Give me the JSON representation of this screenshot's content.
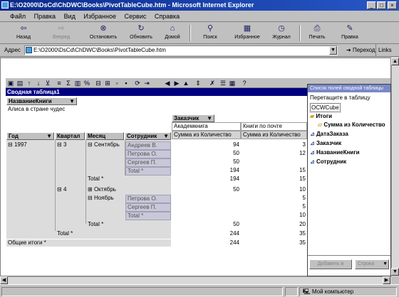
{
  "window": {
    "title": "E:\\O2000\\DsCd\\ChDWC\\Books\\PivotTableCube.htm - Microsoft Internet Explorer"
  },
  "menu": [
    "Файл",
    "Правка",
    "Вид",
    "Избранное",
    "Сервис",
    "Справка"
  ],
  "toolbar": {
    "back": "Назад",
    "forward": "Вперед",
    "stop": "Остановить",
    "refresh": "Обновить",
    "home": "Домой",
    "search": "Поиск",
    "favorites": "Избранное",
    "history": "Журнал",
    "print": "Печать",
    "edit": "Правка"
  },
  "address": {
    "label": "Адрес",
    "value": "E:\\O2000\\DsCd\\ChDWC\\Books\\PivotTableCube.htm",
    "go": "Переход",
    "links": "Links"
  },
  "pivot": {
    "title": "Сводная таблица1",
    "page_field": "НазваниеКниги",
    "page_value": "Алиса в стране чудес",
    "column_field": "Заказчик",
    "columns": [
      "Академкнига",
      "Книги по почте"
    ],
    "measure": "Сумма из Количество",
    "row_headers": {
      "year": "Год",
      "quarter": "Квартал",
      "month": "Месяц",
      "employee": "Сотрудник"
    },
    "year": "1997",
    "q3": "3",
    "q4": "4",
    "september": "Сентябрь",
    "october": "Октябрь",
    "november": "Ноябрь",
    "sep_rows": [
      {
        "name": "Андреев В.",
        "a": "94",
        "b": "3"
      },
      {
        "name": "Петрова О.",
        "a": "50",
        "b": "12"
      },
      {
        "name": "Сергеев П.",
        "a": "50",
        "b": ""
      }
    ],
    "sep_total": {
      "label": "Total",
      "a": "194",
      "b": "15"
    },
    "q3_total": {
      "label": "Total",
      "a": "194",
      "b": "15"
    },
    "oct_row": {
      "a": "50",
      "b": "10"
    },
    "nov_rows": [
      {
        "name": "Петрова О.",
        "a": "",
        "b": "5"
      },
      {
        "name": "Сергеев П.",
        "a": "",
        "b": "5"
      }
    ],
    "nov_total": {
      "label": "Total",
      "a": "",
      "b": "10"
    },
    "q4_total": {
      "label": "Total",
      "a": "50",
      "b": "20"
    },
    "year_total": {
      "label": "Total",
      "a": "244",
      "b": "35"
    },
    "grand_total": {
      "label": "Общие итоги",
      "a": "244",
      "b": "35"
    }
  },
  "field_list": {
    "title": "Список полей сводной таблицы",
    "drag_hint": "Перетащите в таблицу",
    "cube": "OCWCube",
    "totals": "Итоги",
    "measure": "Сумма из Количество",
    "fields": [
      "ДатаЗаказа",
      "Заказчик",
      "НазваниеКниги",
      "Сотрудник"
    ],
    "add_button": "Добавить в",
    "area_select": "Строка"
  },
  "status": {
    "zone": "Мой компьютер"
  }
}
